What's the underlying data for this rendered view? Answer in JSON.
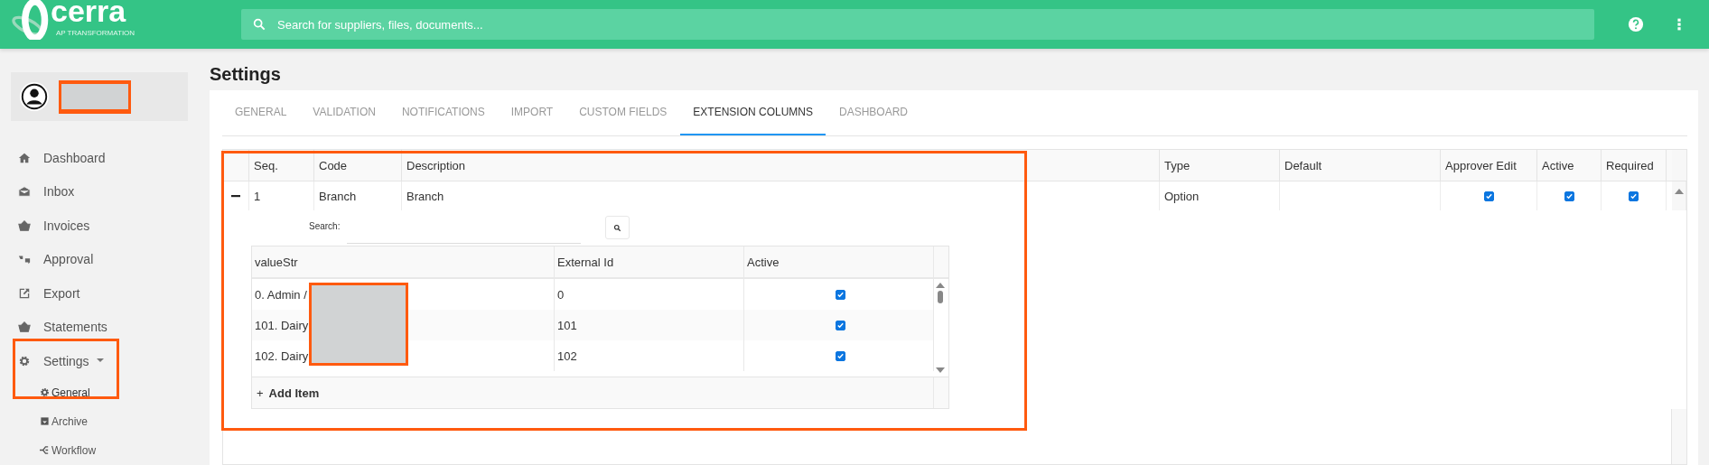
{
  "header": {
    "logo_text": "cerra",
    "logo_tagline": "AP TRANSFORMATION",
    "search_placeholder": "Search for suppliers, files, documents..."
  },
  "sidebar": {
    "items": [
      {
        "label": "Dashboard",
        "selected": false
      },
      {
        "label": "Inbox",
        "selected": false
      },
      {
        "label": "Invoices",
        "selected": false
      },
      {
        "label": "Approval",
        "selected": false
      },
      {
        "label": "Export",
        "selected": false
      },
      {
        "label": "Statements",
        "selected": false
      },
      {
        "label": "Settings",
        "selected": false,
        "expanded": true,
        "children": [
          {
            "label": "General",
            "selected": true
          },
          {
            "label": "Archive",
            "selected": false
          },
          {
            "label": "Workflow",
            "selected": false
          }
        ]
      }
    ]
  },
  "page_title": "Settings",
  "tabs": [
    {
      "label": "GENERAL",
      "selected": false
    },
    {
      "label": "VALIDATION",
      "selected": false
    },
    {
      "label": "NOTIFICATIONS",
      "selected": false
    },
    {
      "label": "IMPORT",
      "selected": false
    },
    {
      "label": "CUSTOM FIELDS",
      "selected": false
    },
    {
      "label": "EXTENSION COLUMNS",
      "selected": true
    },
    {
      "label": "DASHBOARD",
      "selected": false
    }
  ],
  "table": {
    "columns": [
      "Seq.",
      "Code",
      "Description",
      "Type",
      "Default",
      "Approver Edit",
      "Active",
      "Required"
    ],
    "rows": [
      {
        "expanded": true,
        "seq": "1",
        "code": "Branch",
        "description": "Branch",
        "type": "Option",
        "approver_edit": true,
        "active": true,
        "required": true
      }
    ]
  },
  "values": {
    "search_label": "Search:",
    "columns": [
      "valueStr",
      "External Id",
      "Active"
    ],
    "rows": [
      {
        "value_str": "0. Admin /",
        "external_id": "0",
        "active": true
      },
      {
        "value_str": "101. Dairy",
        "external_id": "101",
        "active": true
      },
      {
        "value_str": "102. Dairy",
        "external_id": "102",
        "active": true
      }
    ],
    "add_icon": "+",
    "add_label": "Add Item"
  }
}
